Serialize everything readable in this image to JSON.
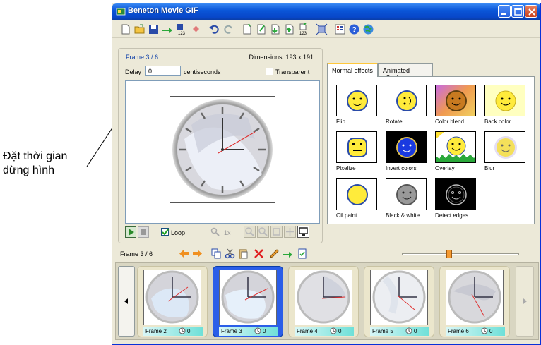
{
  "annotation": {
    "line1": "Đặt thời gian",
    "line2": "dừng hình"
  },
  "window": {
    "title": "Beneton Movie GIF"
  },
  "toolbar": {
    "icons": [
      "new-file-icon",
      "open-folder-icon",
      "save-icon",
      "save-as-icon",
      "save-numbered-icon",
      "reload-icon",
      "undo-icon",
      "redo-icon",
      "insert-frame-icon",
      "edit-frame-icon",
      "import-frame-icon",
      "export-frame-icon",
      "numbered-frames-icon",
      "fit-icon",
      "properties-icon",
      "help-icon",
      "web-icon"
    ]
  },
  "editor": {
    "frame_label": "Frame 3 / 6",
    "dimensions": "Dimensions: 193 x 191",
    "delay_label": "Delay",
    "delay_value": "0",
    "centiseconds": "centiseconds",
    "transparent_label": "Transparent",
    "transparent_checked": false,
    "loop_label": "Loop",
    "loop_checked": true,
    "zoom": "1x"
  },
  "effects": {
    "tabs": [
      "Normal effects",
      "Animated effects"
    ],
    "active_tab": "Normal effects",
    "items": [
      "Flip",
      "Rotate",
      "Color blend",
      "Back color",
      "Pixelize",
      "Invert colors",
      "Overlay",
      "Blur",
      "Oil paint",
      "Black & white",
      "Detect edges"
    ]
  },
  "strip": {
    "frame_label": "Frame 3 / 6",
    "frames": [
      {
        "name": "Frame 2",
        "delay": "0",
        "selected": false
      },
      {
        "name": "Frame 3",
        "delay": "0",
        "selected": true
      },
      {
        "name": "Frame 4",
        "delay": "0",
        "selected": false
      },
      {
        "name": "Frame 5",
        "delay": "0",
        "selected": false
      },
      {
        "name": "Frame 6",
        "delay": "0",
        "selected": false
      }
    ]
  },
  "colors": {
    "titlebar": "#0a56d8",
    "selected_frame": "#2b5ee8",
    "frame_label_blue": "#0a3da8",
    "slider_thumb": "#f59b32"
  }
}
